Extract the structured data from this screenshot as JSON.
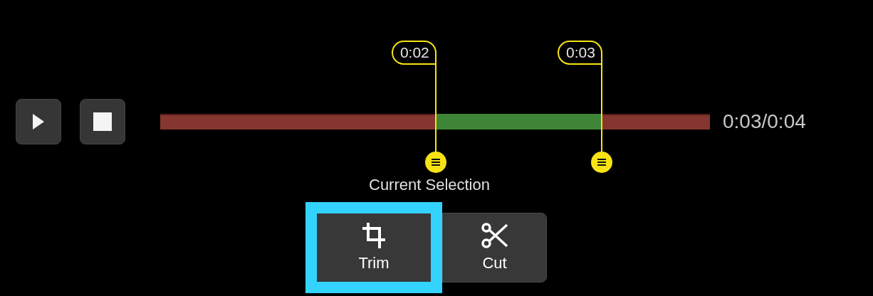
{
  "transport": {
    "buttons": [
      {
        "kind": "play"
      },
      {
        "kind": "stop"
      }
    ]
  },
  "timeline": {
    "markers": [
      {
        "label": "0:02",
        "level": 0.501
      },
      {
        "label": "0:03",
        "level": 0.803
      }
    ],
    "time": "0:03/0:04"
  },
  "selection": {
    "title": "Current Selection",
    "actions": [
      {
        "kind": "trim",
        "label": "Trim",
        "selected": true
      },
      {
        "kind": "cut",
        "label": "Cut",
        "selected": false
      }
    ]
  }
}
